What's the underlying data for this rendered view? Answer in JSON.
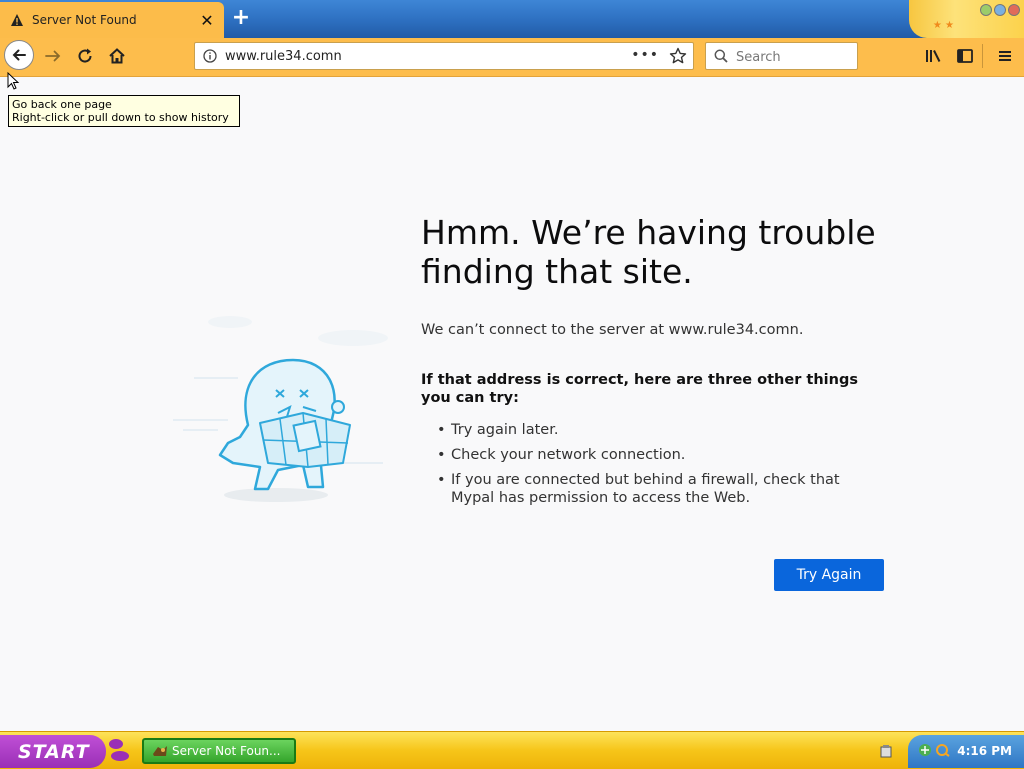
{
  "browser": {
    "tab": {
      "title": "Server Not Found",
      "close_glyph": "✕"
    },
    "new_tab_glyph": "+",
    "url": "www.rule34.comn",
    "page_actions_glyph": "•••",
    "search": {
      "placeholder": "Search"
    }
  },
  "tooltip": {
    "line1": "Go back one page",
    "line2": "Right-click or pull down to show history"
  },
  "error": {
    "heading_line1": "Hmm. We’re having trouble",
    "heading_line2": "finding that site.",
    "intro": "We can’t connect to the server at www.rule34.comn.",
    "subhead": "If that address is correct, here are three other things you can try:",
    "tips": [
      "Try again later.",
      "Check your network connection.",
      "If you are connected but behind a firewall, check that Mypal has permission to access the Web."
    ],
    "try_again_label": "Try Again"
  },
  "taskbar": {
    "start_label": "START",
    "task_label": "Server Not Foun...",
    "clock": "4:16 PM"
  },
  "colors": {
    "accent": "#0a66dc",
    "toolbar": "#fdbd4c",
    "tabbar": "#2d6fc0",
    "taskbar": "#f6c519"
  }
}
